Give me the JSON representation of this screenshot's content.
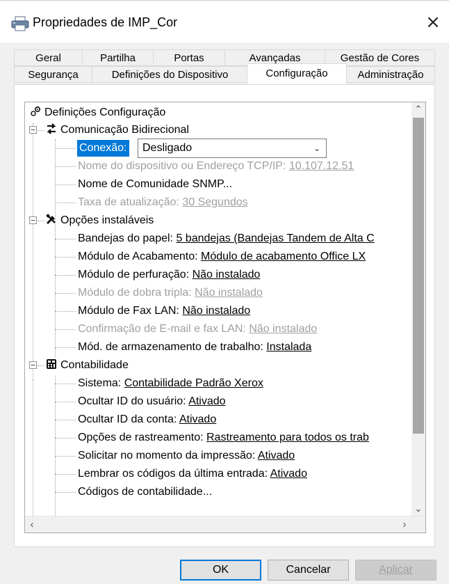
{
  "window": {
    "title": "Propriedades de IMP_Cor",
    "close_icon": "×"
  },
  "tabs_row1": [
    "Geral",
    "Partilha",
    "Portas",
    "Avançadas",
    "Gestão de Cores"
  ],
  "tabs_row2": [
    "Segurança",
    "Definições do Dispositivo",
    "Configuração",
    "Administração"
  ],
  "active_tab": "Configuração",
  "tree": {
    "root": "Definições Configuração",
    "comm": {
      "label": "Comunicação Bidirecional",
      "conexao_label": "Conexão:",
      "conexao_value": "Desligado",
      "device_label": "Nome do dispositivo ou Endereço TCP/IP:",
      "device_value": "10.107.12.51",
      "snmp": "Nome de Comunidade SNMP...",
      "rate_label": "Taxa de atualização:",
      "rate_value": "30 Segundos"
    },
    "options": {
      "label": "Opções instaláveis",
      "items": [
        {
          "label": "Bandejas do papel:",
          "value": "5 bandejas (Bandejas Tandem de Alta C",
          "disabled": false
        },
        {
          "label": "Módulo de Acabamento:",
          "value": "Módulo de acabamento Office LX",
          "disabled": false
        },
        {
          "label": "Módulo de perfuração:",
          "value": "Não instalado",
          "disabled": false
        },
        {
          "label": "Módulo de dobra tripla:",
          "value": "Não instalado",
          "disabled": true
        },
        {
          "label": "Módulo de Fax LAN:",
          "value": "Não instalado",
          "disabled": false
        },
        {
          "label": "Confirmação de E-mail e fax LAN:",
          "value": "Não instalado",
          "disabled": true
        },
        {
          "label": "Mód. de armazenamento de trabalho:",
          "value": "Instalada",
          "disabled": false
        }
      ]
    },
    "accounting": {
      "label": "Contabilidade",
      "items": [
        {
          "label": "Sistema:",
          "value": "Contabilidade Padrão Xerox"
        },
        {
          "label": "Ocultar ID do usuário:",
          "value": "Ativado"
        },
        {
          "label": "Ocultar ID da conta:",
          "value": "Ativado"
        },
        {
          "label": "Opções de rastreamento:",
          "value": "Rastreamento para todos os trab"
        },
        {
          "label": "Solicitar no momento da impressão:",
          "value": "Ativado"
        },
        {
          "label": "Lembrar os códigos da última entrada:",
          "value": "Ativado"
        },
        {
          "label": "Códigos de contabilidade...",
          "value": ""
        }
      ]
    }
  },
  "buttons": {
    "ok": "OK",
    "cancel": "Cancelar",
    "apply": "Aplicar"
  },
  "colors": {
    "selection": "#0078d7",
    "disabled_text": "#a0a0a0"
  }
}
